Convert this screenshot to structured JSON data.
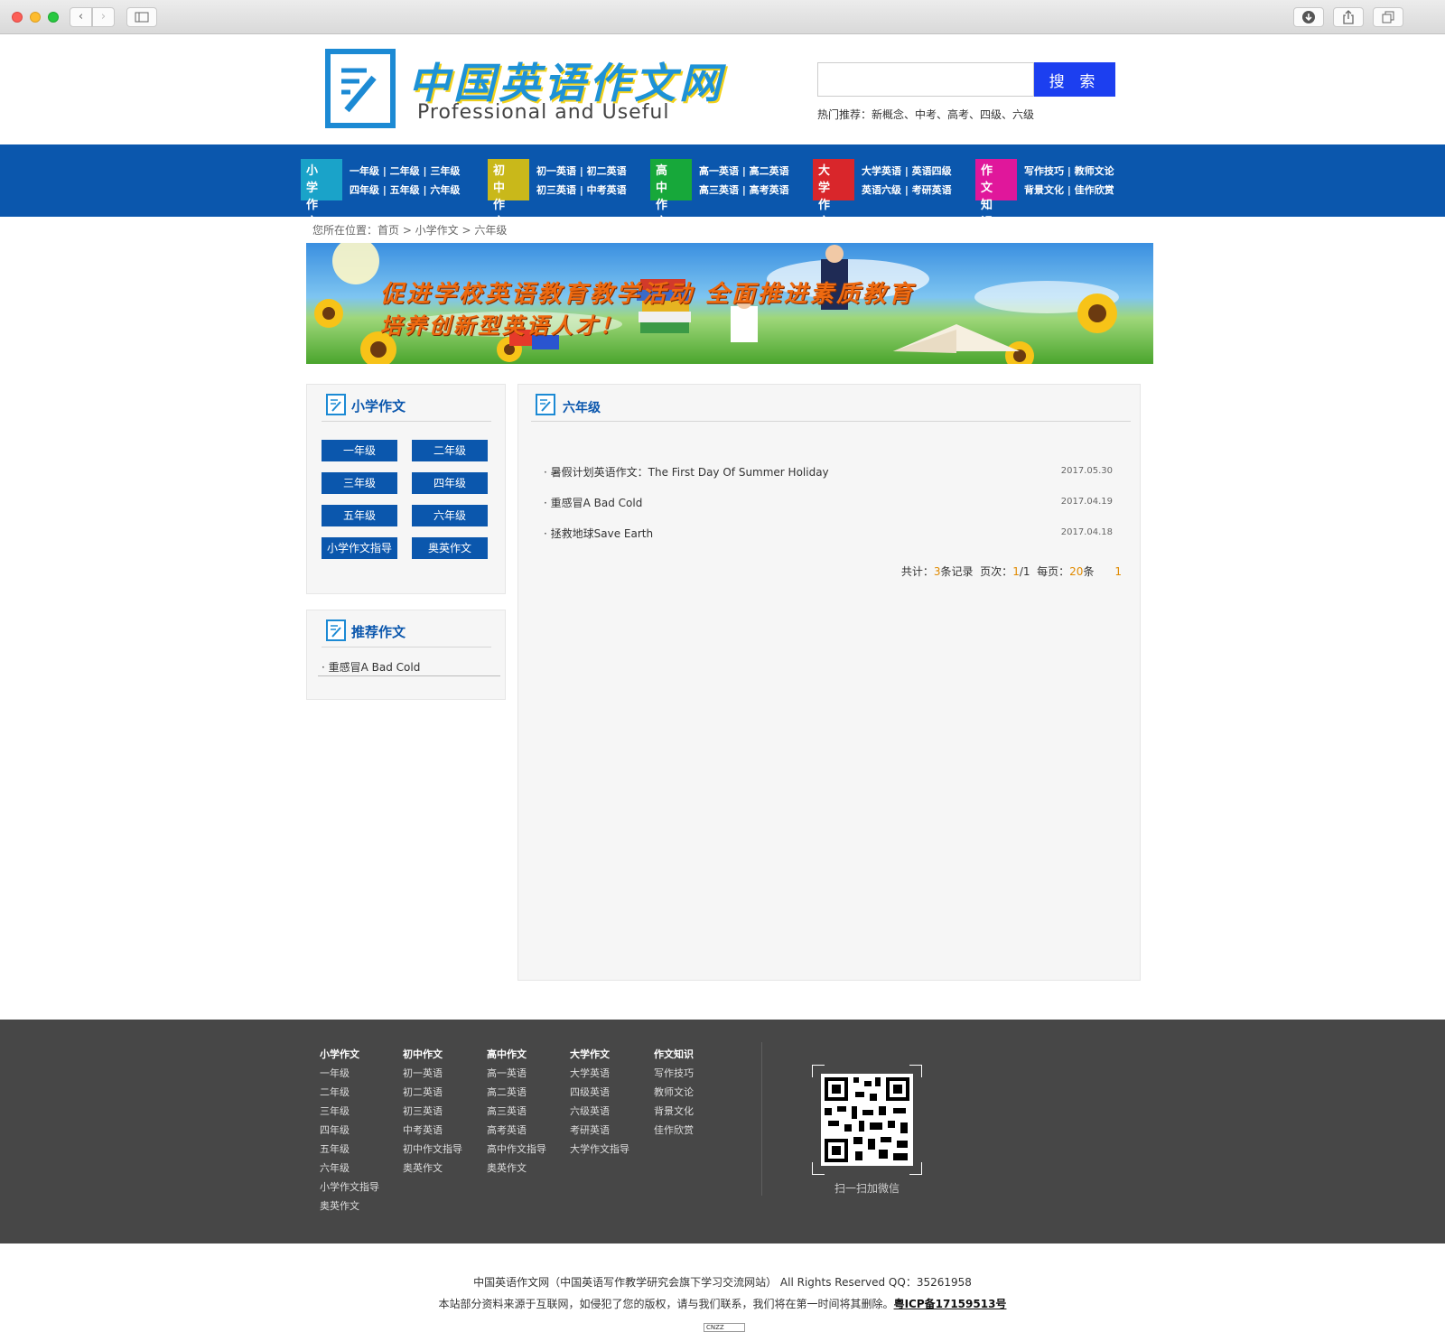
{
  "header": {
    "logo_cn": "中国英语作文网",
    "logo_en": "Professional and Useful",
    "search_placeholder": "",
    "search_button": "搜 索",
    "hot_label": "热门推荐：",
    "hot_links": "新概念、中考、高考、四级、六级"
  },
  "nav": [
    {
      "tag": "小 学 作 文",
      "color": "#1aa3c9",
      "line1": "一年级 | 二年级 | 三年级",
      "line2": "四年级 | 五年级 | 六年级"
    },
    {
      "tag": "初 中 作 文",
      "color": "#c9b81a",
      "line1": "初一英语 | 初二英语",
      "line2": "初三英语 | 中考英语"
    },
    {
      "tag": "高 中 作 文",
      "color": "#17a83a",
      "line1": "高一英语 | 高二英语",
      "line2": "高三英语 | 高考英语"
    },
    {
      "tag": "大 学 作 文",
      "color": "#d9262b",
      "line1": "大学英语 | 英语四级",
      "line2": "英语六级 | 考研英语"
    },
    {
      "tag": "作 文 知 识",
      "color": "#e0179b",
      "line1": "写作技巧 | 教师文论",
      "line2": "背景文化 | 佳作欣赏"
    }
  ],
  "breadcrumb": "您所在位置：首页 > 小学作文 >  六年级",
  "banner": {
    "line1": "促进学校英语教育教学活动   全面推进素质教育",
    "line2": "培养创新型英语人才！"
  },
  "side": {
    "title": "小学作文",
    "grades": [
      "一年级",
      "二年级",
      "三年级",
      "四年级",
      "五年级",
      "六年级",
      "小学作文指导",
      "奥英作文"
    ],
    "rec_title": "推荐作文",
    "rec_items": [
      "· 重感冒A Bad Cold"
    ]
  },
  "main": {
    "title": "六年级",
    "items": [
      {
        "title": "· 暑假计划英语作文：The First Day Of Summer Holiday",
        "date": "2017.05.30"
      },
      {
        "title": "· 重感冒A Bad Cold",
        "date": "2017.04.19"
      },
      {
        "title": "· 拯救地球Save Earth",
        "date": "2017.04.18"
      }
    ],
    "pager": {
      "total_label": "共计：",
      "total": "3",
      "records": "条记录",
      "page_label": "页次：",
      "page": "1",
      "pages": "/1",
      "per_label": "每页：",
      "per": "20",
      "per_unit": "条",
      "current": "1"
    }
  },
  "footer": {
    "columns": [
      {
        "head": "小学作文",
        "items": [
          "一年级",
          "二年级",
          "三年级",
          "四年级",
          "五年级",
          "六年级",
          "小学作文指导",
          "奥英作文"
        ]
      },
      {
        "head": "初中作文",
        "items": [
          "初一英语",
          "初二英语",
          "初三英语",
          "中考英语",
          "初中作文指导",
          "奥英作文"
        ]
      },
      {
        "head": "高中作文",
        "items": [
          "高一英语",
          "高二英语",
          "高三英语",
          "高考英语",
          "高中作文指导",
          "奥英作文"
        ]
      },
      {
        "head": "大学作文",
        "items": [
          "大学英语",
          "四级英语",
          "六级英语",
          "考研英语",
          "大学作文指导"
        ]
      },
      {
        "head": "作文知识",
        "items": [
          "写作技巧",
          "教师文论",
          "背景文化",
          "佳作欣赏"
        ]
      }
    ],
    "qr_caption": "扫一扫加微信",
    "copyright": "中国英语作文网（中国英语写作教学研究会旗下学习交流网站） All Rights Reserved  QQ：35261958",
    "notice": "本站部分资料来源于互联网，如侵犯了您的版权，请与我们联系，我们将在第一时间将其删除。",
    "icp": "粤ICP备17159513号",
    "cnzz": "CNZZ"
  }
}
